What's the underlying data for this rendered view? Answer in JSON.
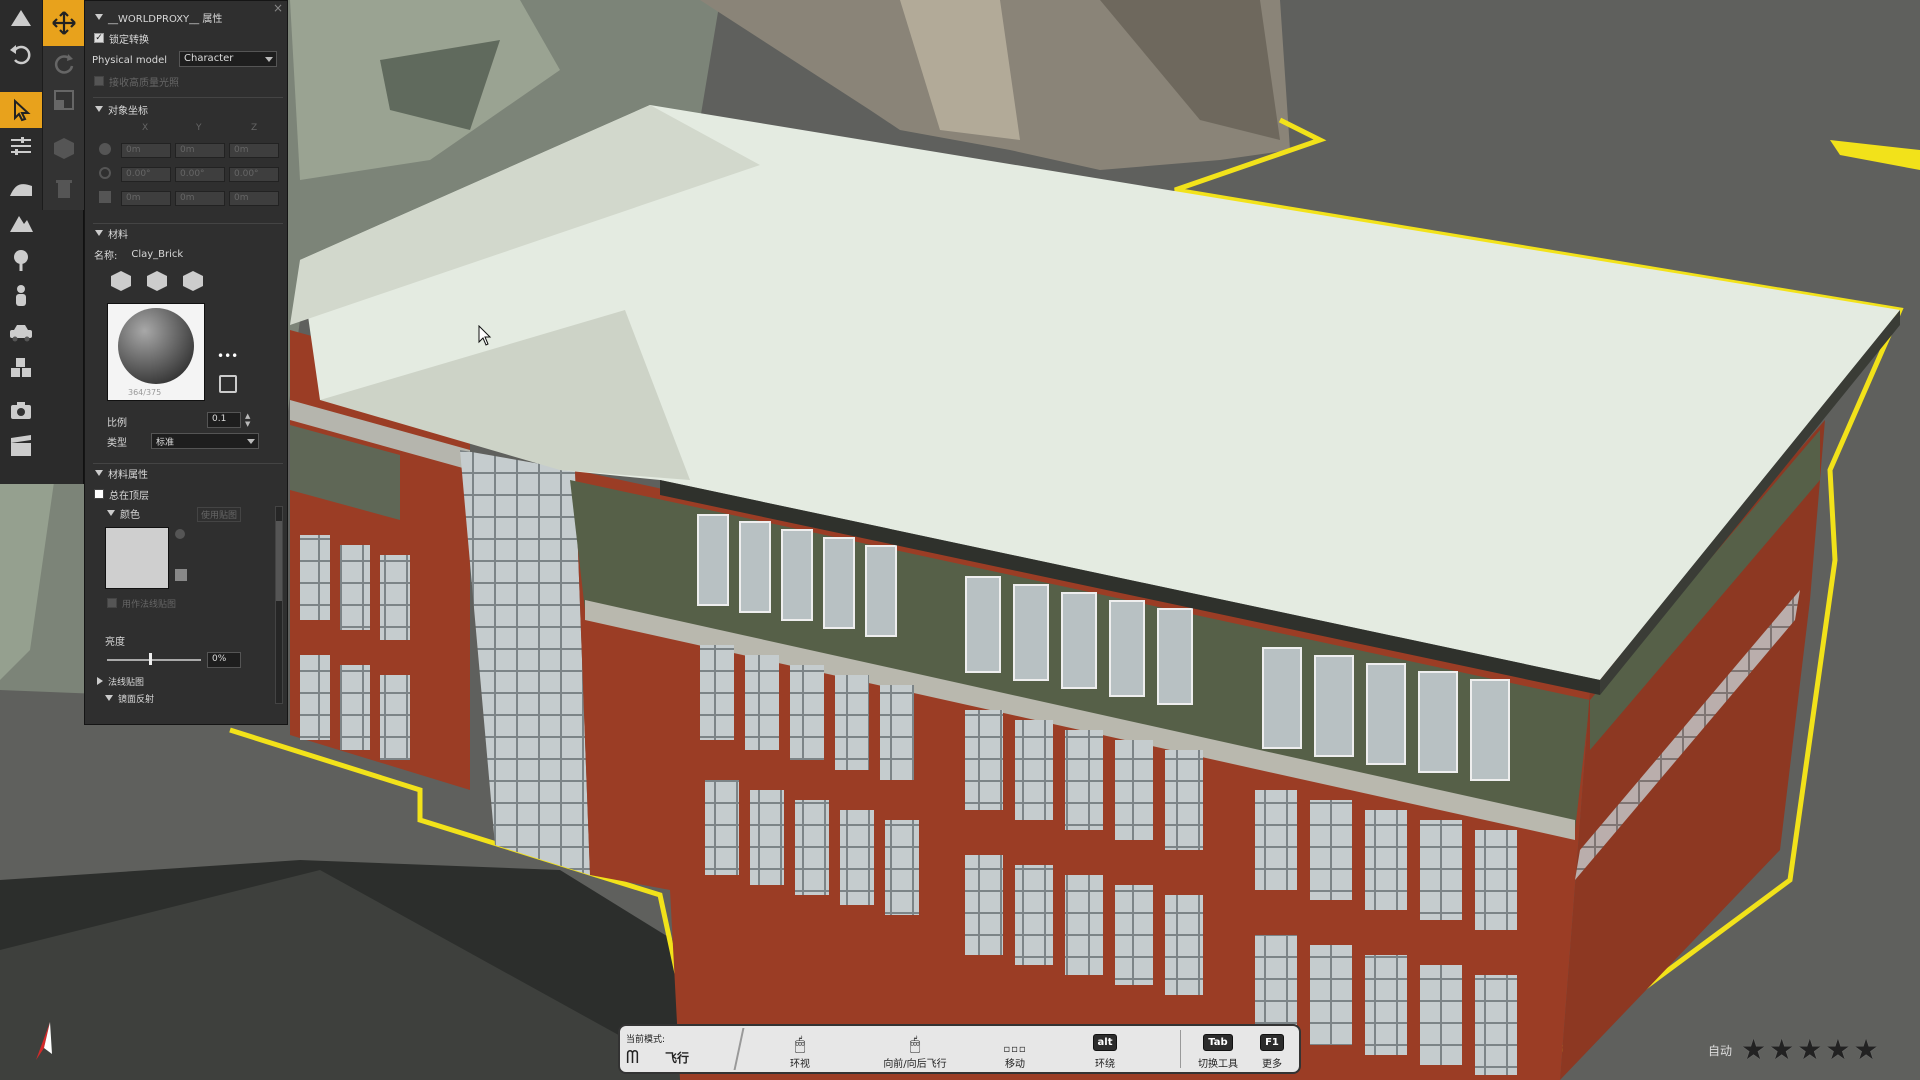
{
  "panel": {
    "title": "__WORLDPROXY__ 属性",
    "lock_transform": "锁定转换",
    "physical_model_label": "Physical model",
    "physical_model_value": "Character",
    "receive_hq_light": "接收高质量光照",
    "object_coords_header": "对象坐标",
    "axes": [
      "X",
      "Y",
      "Z"
    ],
    "position": [
      "0m",
      "0m",
      "0m"
    ],
    "rotation": [
      "0.00°",
      "0.00°",
      "0.00°"
    ],
    "scale": [
      "0m",
      "0m",
      "0m"
    ],
    "material_header": "材料",
    "name_label": "名称:",
    "name_value": "Clay_Brick",
    "preview_info": "364/375",
    "more": "•••",
    "ratio_label": "比例",
    "ratio_value": "0.1",
    "type_label": "类型",
    "type_value": "标准",
    "material_props_header": "材料属性",
    "always_on_top": "总在顶层",
    "color_header": "颜色",
    "use_texture": "使用贴图",
    "use_normal_map": "用作法线贴图",
    "brightness_label": "亮度",
    "brightness_value": "0%",
    "brightness_level": 0.45,
    "normal_map_header": "法线贴图",
    "reflection_header": "镜面反射",
    "close": "×"
  },
  "modebar": {
    "current_mode_label": "当前模式:",
    "current_mode_value": "飞行",
    "look_around": "环视",
    "fly_forward_back": "向前/向后飞行",
    "move": "移动",
    "alt_key": "alt",
    "alt_label": "环绕",
    "tab_key": "Tab",
    "tab_label": "切换工具",
    "f1_key": "F1",
    "f1_label": "更多"
  },
  "rating": {
    "label": "自动",
    "stars": [
      "★",
      "★",
      "★",
      "★",
      "★"
    ]
  },
  "colors": {
    "accent": "#e8a21c",
    "selection_outline": "#f2e21a",
    "brick": "#9b3d25",
    "roof": "#e4ebe1"
  }
}
